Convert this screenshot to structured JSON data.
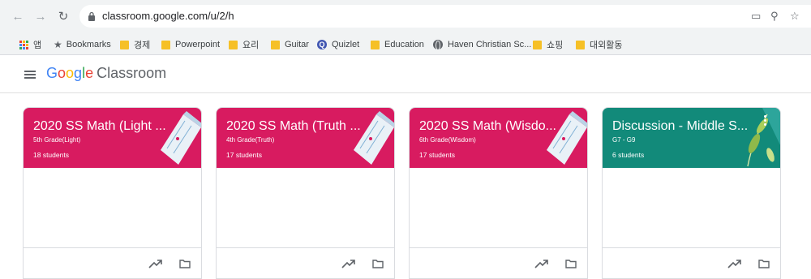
{
  "browser": {
    "url": "classroom.google.com/u/2/h",
    "bookmarks": [
      {
        "label": "앱",
        "icon": "apps-icon"
      },
      {
        "label": "Bookmarks",
        "icon": "star-icon"
      },
      {
        "label": "경제",
        "icon": "folder-icon"
      },
      {
        "label": "Powerpoint",
        "icon": "folder-icon"
      },
      {
        "label": "요리",
        "icon": "folder-icon"
      },
      {
        "label": "Guitar",
        "icon": "folder-icon"
      },
      {
        "label": "Quizlet",
        "icon": "quizlet-icon"
      },
      {
        "label": "Education",
        "icon": "folder-icon"
      },
      {
        "label": "Haven Christian Sc...",
        "icon": "globe-icon"
      },
      {
        "label": "쇼핑",
        "icon": "folder-icon"
      },
      {
        "label": "대외활동",
        "icon": "folder-icon"
      }
    ]
  },
  "header": {
    "logo_google": "Google",
    "logo_product": "Classroom"
  },
  "classes": [
    {
      "title": "2020 SS Math (Light ...",
      "section": "5th Grade(Light)",
      "students": "18 students",
      "color": "#d81b60",
      "theme": "math"
    },
    {
      "title": "2020 SS Math (Truth ...",
      "section": "4th Grade(Truth)",
      "students": "17 students",
      "color": "#d81b60",
      "theme": "math"
    },
    {
      "title": "2020 SS Math (Wisdo...",
      "section": "6th Grade(Wisdom)",
      "students": "17 students",
      "color": "#d81b60",
      "theme": "math"
    },
    {
      "title": "Discussion - Middle S...",
      "section": "G7 - G9",
      "students": "6 students",
      "color": "#128a7a",
      "theme": "leaves"
    }
  ],
  "colors": {
    "chrome_bg": "#f1f3f4",
    "bookmark_folder": "#f6c026",
    "math_card": "#d81b60",
    "discussion_card": "#128a7a"
  }
}
